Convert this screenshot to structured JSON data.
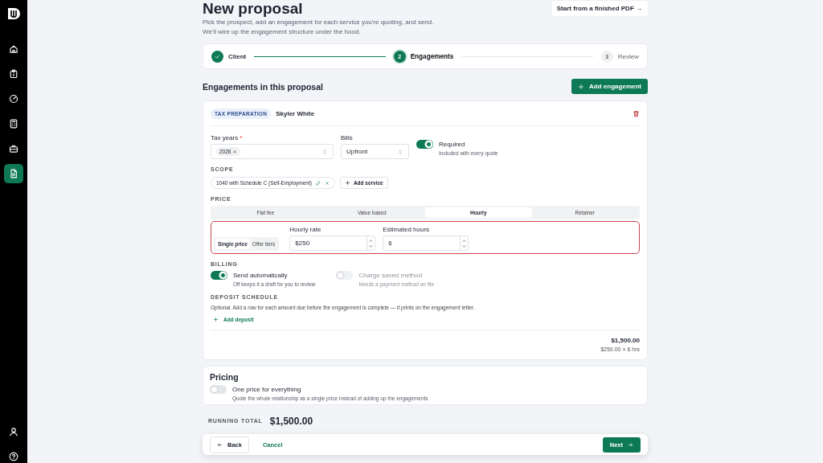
{
  "sidebar": {
    "items": [
      {
        "selected": false
      },
      {
        "selected": false
      },
      {
        "selected": false
      },
      {
        "selected": false
      },
      {
        "selected": false
      },
      {
        "selected": true
      }
    ],
    "bottom_items": [
      {
        "selected": false
      },
      {
        "selected": false
      }
    ]
  },
  "header": {
    "title": "New proposal",
    "subtitle": "Pick the prospect, add an engagement for each service you're quoting, and send. We'll wire up the engagement structure under the hood.",
    "pdf_button": "Start from a finished PDF →"
  },
  "stepper": {
    "steps": [
      {
        "label": "Client",
        "done": true,
        "selected": false
      },
      {
        "number": "2",
        "label": "Engagements",
        "done": false,
        "selected": true
      },
      {
        "number": "3",
        "label": "Review",
        "done": false,
        "selected": false
      }
    ]
  },
  "section_title": "Engagements in this proposal",
  "add_engagement": "Add engagement",
  "engagement": {
    "tag": "TAX PREPARATION",
    "client": "Skyler White",
    "tax_years": {
      "label": "Tax years",
      "required_mark": "*",
      "chips": [
        "2026"
      ]
    },
    "bills": {
      "label": "Bills",
      "value": "Upfront"
    },
    "required_toggle": {
      "label": "Required",
      "hint": "Included with every quote",
      "on": true
    },
    "scope": {
      "heading": "SCOPE",
      "services": [
        "1040 with Schedule C (Self-Employment)"
      ],
      "add": "Add service"
    },
    "price": {
      "heading": "PRICE",
      "highlighted": true,
      "tabs": [
        {
          "label": "Flat fee",
          "selected": false
        },
        {
          "label": "Value based",
          "selected": false
        },
        {
          "label": "Hourly",
          "selected": true
        },
        {
          "label": "Retainer",
          "selected": false
        }
      ],
      "modes": [
        {
          "label": "Single price",
          "selected": true
        },
        {
          "label": "Offer tiers",
          "selected": false
        }
      ],
      "fields": [
        {
          "label": "Hourly rate",
          "value": "$250"
        },
        {
          "label": "Estimated hours",
          "value": "6"
        }
      ]
    },
    "billing": {
      "heading": "BILLING",
      "toggles": [
        {
          "label": "Send automatically",
          "hint": "Off keeps it a draft for you to review",
          "on": true,
          "disabled": false
        },
        {
          "label": "Charge saved method",
          "hint": "Needs a payment method on file",
          "on": false,
          "disabled": true
        }
      ]
    },
    "deposit": {
      "heading": "DEPOSIT SCHEDULE",
      "text": "Optional. Add a row for each amount due before the engagement is complete — it prints on the engagement letter.",
      "add": "Add deposit"
    },
    "total": {
      "amount": "$1,500.00",
      "breakdown": "$250.00 × 6 hrs"
    }
  },
  "pricing": {
    "title": "Pricing",
    "toggle": {
      "label": "One price for everything",
      "hint": "Quote the whole relationship as a single price instead of adding up the engagements",
      "on": false
    }
  },
  "running_total": {
    "label": "RUNNING TOTAL",
    "amount": "$1,500.00"
  },
  "footer": {
    "back": "Back",
    "cancel": "Cancel",
    "next": "Next"
  }
}
